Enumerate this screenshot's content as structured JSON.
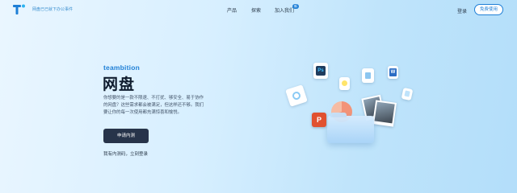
{
  "header": {
    "tagline": "网盘已已就下办公事件",
    "nav": {
      "products": "产品",
      "explore": "探索",
      "join": "加入我们",
      "join_badge": "新"
    },
    "login": "登录",
    "free_use": "免费使用"
  },
  "hero": {
    "brand": "teambition",
    "title": "网盘",
    "description": "你想要的是一款不限速、不打扰、够安全、易于协作的网盘？这些需求都会被满足，但这样还不够。我们要让你的每一次使用都充满惊喜和愉悦。",
    "apply_button": "申请内测",
    "invite_code_link": "我有内测码，立刻登录"
  },
  "illustration": {
    "ps_label": "Ps",
    "word_label": "W",
    "ppt_label": "P"
  },
  "colors": {
    "accent": "#1e7fd6",
    "dark_button": "#27344a",
    "title": "#0f1c2e"
  }
}
